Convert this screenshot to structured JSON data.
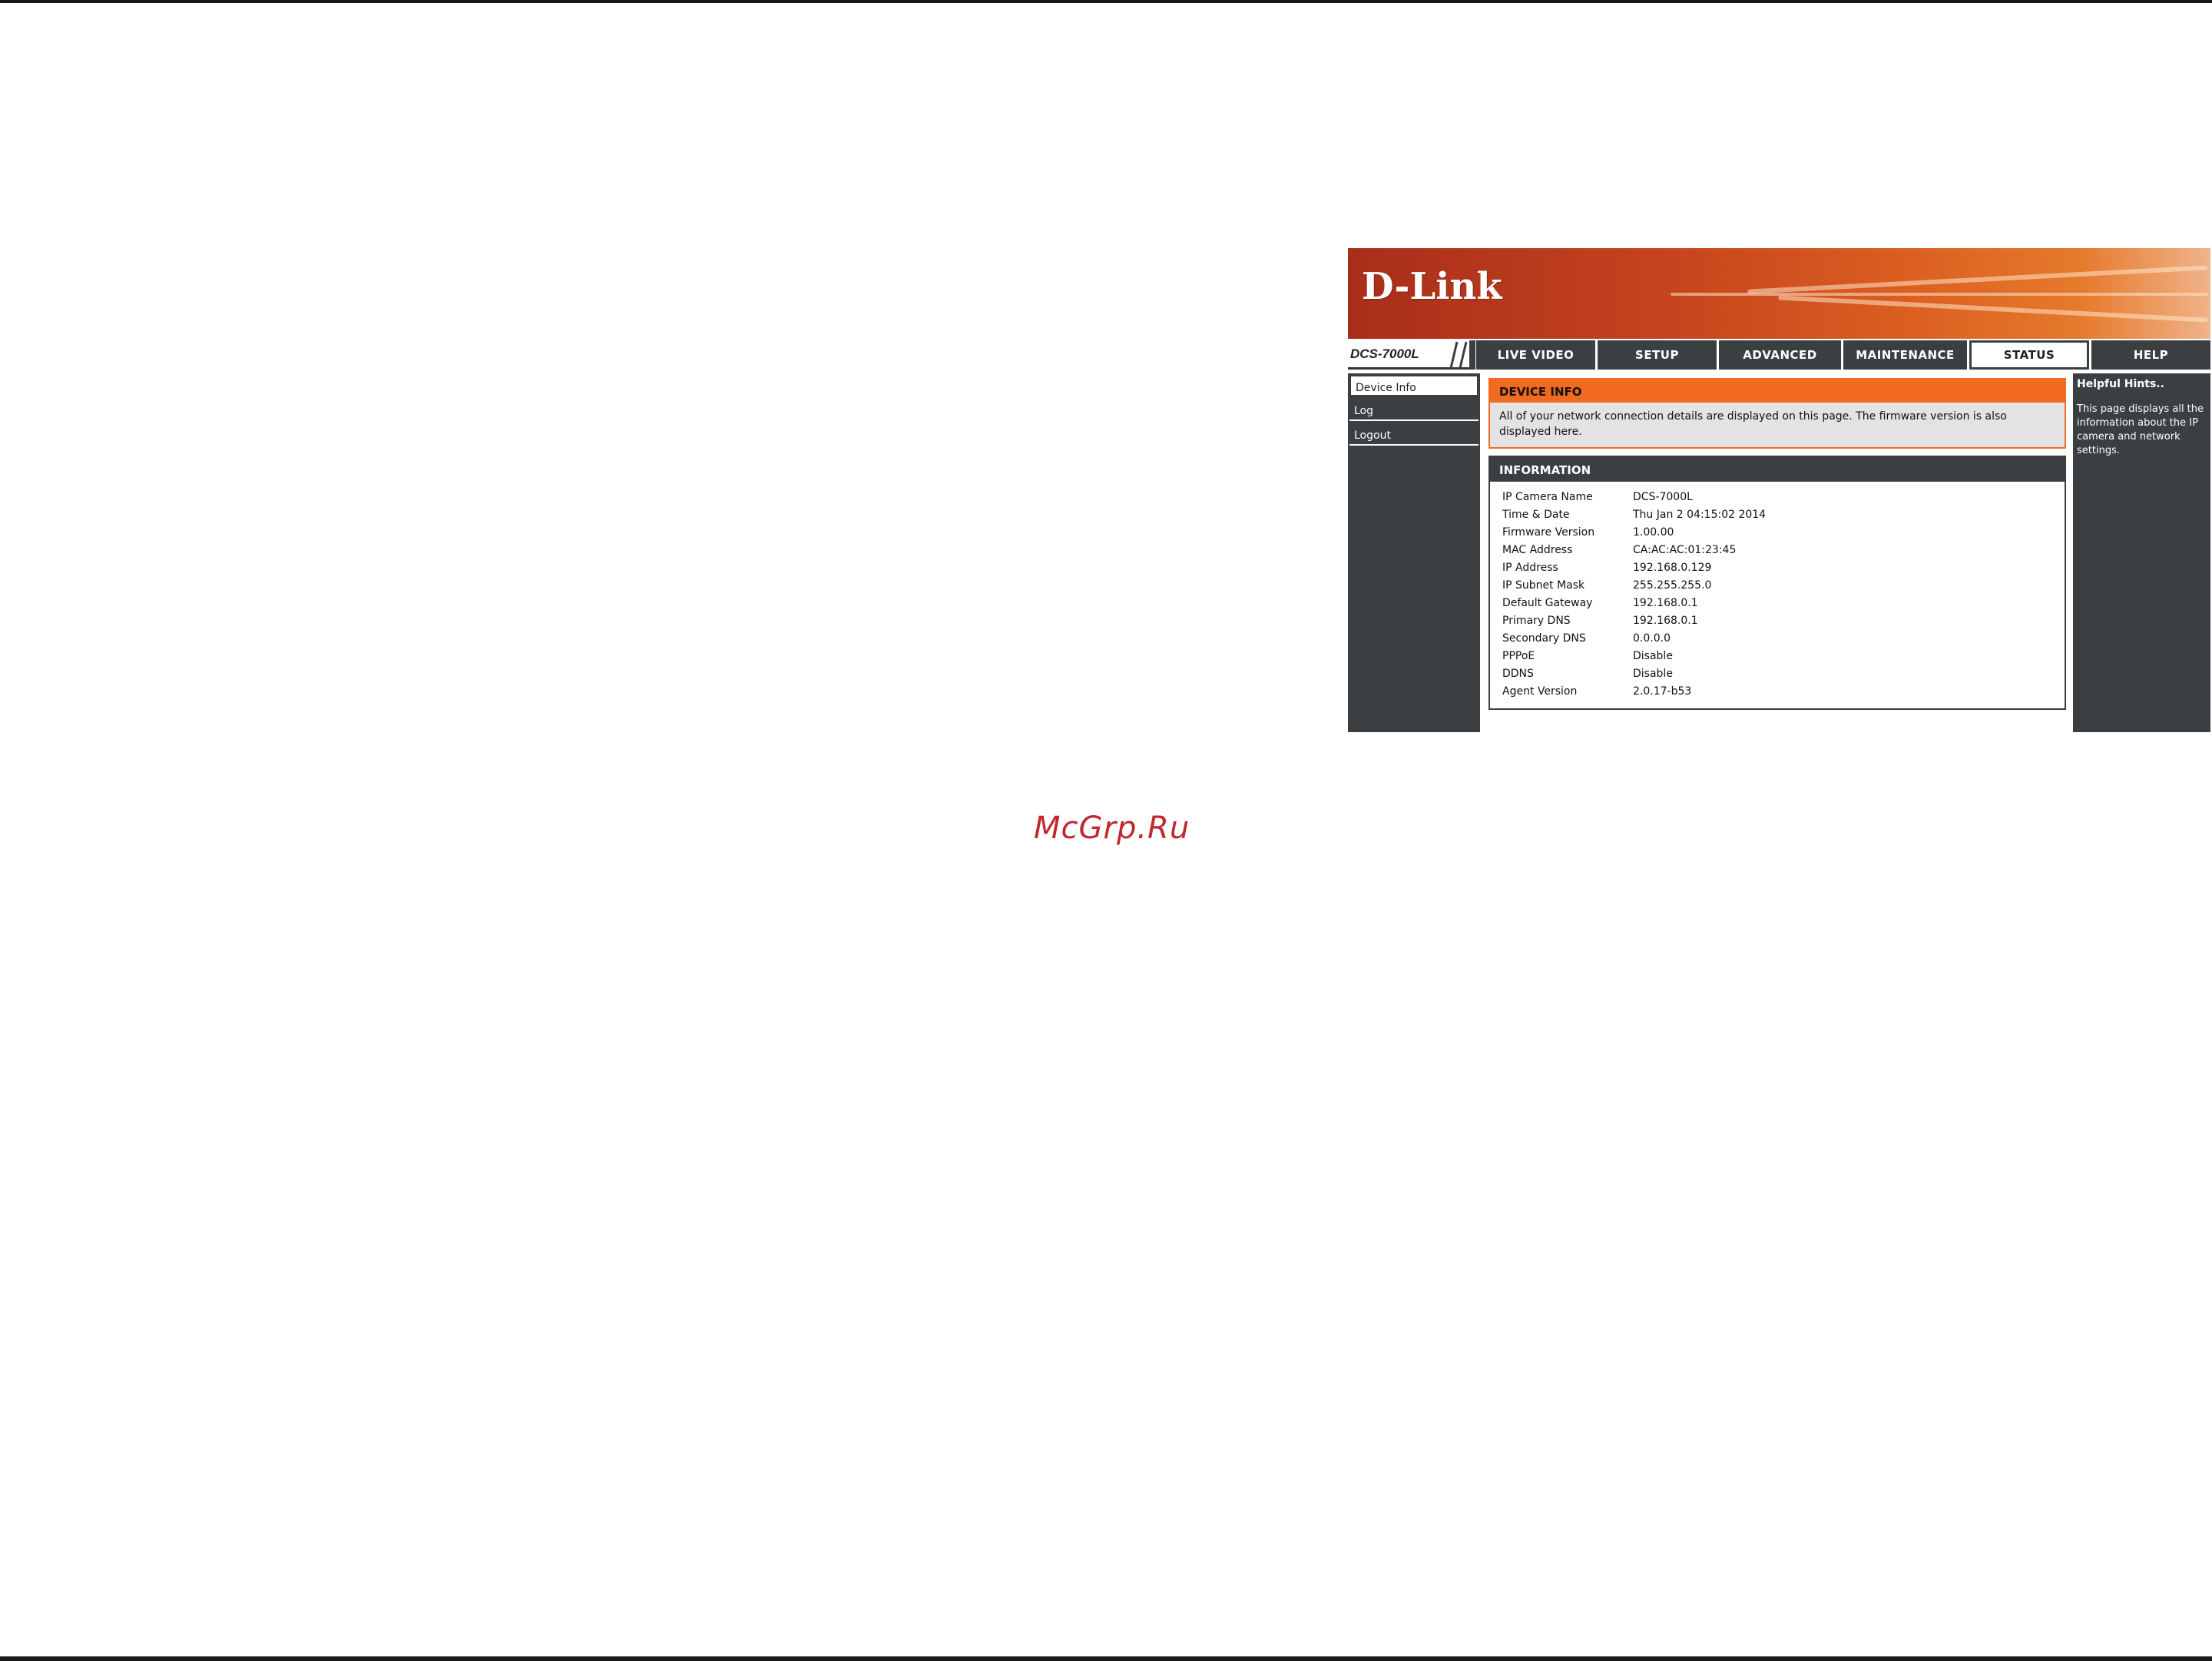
{
  "watermark": "McGrp.Ru",
  "brand": {
    "logo_text": "D-Link",
    "model": "DCS-7000L",
    "colors": {
      "banner_dark": "#a82e1a",
      "banner_light": "#e67a2c",
      "accent": "#f26a21",
      "panel": "#3b3f42"
    }
  },
  "tabs": [
    {
      "label": "LIVE VIDEO",
      "active": false
    },
    {
      "label": "SETUP",
      "active": false
    },
    {
      "label": "ADVANCED",
      "active": false
    },
    {
      "label": "MAINTENANCE",
      "active": false
    },
    {
      "label": "STATUS",
      "active": true
    },
    {
      "label": "HELP",
      "active": false
    }
  ],
  "sidebar": {
    "items": [
      {
        "label": "Device Info",
        "active": true
      },
      {
        "label": "Log",
        "active": false
      },
      {
        "label": "Logout",
        "active": false
      }
    ]
  },
  "device_info": {
    "title": "DEVICE INFO",
    "description": "All of your network connection details are displayed on this page. The firmware version is also displayed here."
  },
  "information": {
    "title": "INFORMATION",
    "rows": [
      {
        "key": "IP Camera Name",
        "value": "DCS-7000L"
      },
      {
        "key": "Time & Date",
        "value": "Thu Jan 2 04:15:02 2014"
      },
      {
        "key": "Firmware Version",
        "value": "1.00.00"
      },
      {
        "key": "MAC Address",
        "value": "CA:AC:AC:01:23:45"
      },
      {
        "key": "IP Address",
        "value": "192.168.0.129"
      },
      {
        "key": "IP Subnet Mask",
        "value": "255.255.255.0"
      },
      {
        "key": "Default Gateway",
        "value": "192.168.0.1"
      },
      {
        "key": "Primary DNS",
        "value": "192.168.0.1"
      },
      {
        "key": "Secondary DNS",
        "value": "0.0.0.0"
      },
      {
        "key": "PPPoE",
        "value": "Disable"
      },
      {
        "key": "DDNS",
        "value": "Disable"
      },
      {
        "key": "Agent Version",
        "value": "2.0.17-b53"
      }
    ]
  },
  "help": {
    "title": "Helpful Hints..",
    "text": "This page displays all the information about the IP camera and network settings."
  }
}
